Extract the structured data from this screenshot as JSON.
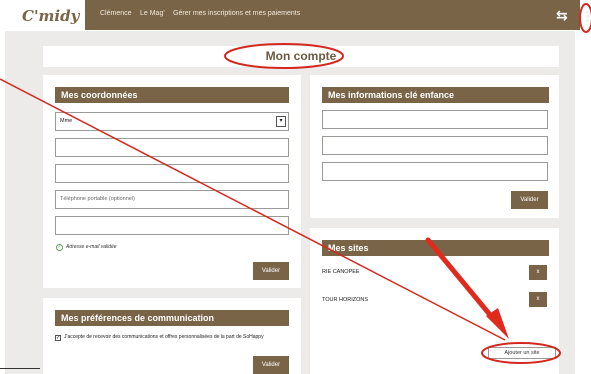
{
  "header": {
    "logo": "C'midy",
    "nav": [
      "Clémence",
      "Le Mag'",
      "Gérer mes inscriptions et mes paiements"
    ],
    "icons": [
      "swap-icon",
      "kebab-menu-icon"
    ]
  },
  "page": {
    "title": "Mon compte"
  },
  "coordonnees": {
    "title": "Mes coordonnées",
    "civilite_value": "Mme",
    "phone_placeholder": "Téléphone portable (optionnel)",
    "email_validated": "Adresse e-mail validée",
    "submit": "Valider"
  },
  "enfance": {
    "title": "Mes informations clé enfance",
    "submit": "Valider"
  },
  "sites": {
    "title": "Mes sites",
    "items": [
      {
        "name": "RIE CANOPEE",
        "remove": "x"
      },
      {
        "name": "TOUR HORIZONS",
        "remove": "x"
      }
    ],
    "add": "Ajouter un site"
  },
  "preferences": {
    "title": "Mes préférences de communication",
    "checkbox_mark": "✓",
    "consent": "J'accepte de recevoir des communications et offres personnalisées de la part de SoHappy",
    "submit": "Valider"
  },
  "colors": {
    "brand": "#7a6447",
    "annotation": "#d4281e",
    "background": "#ecebe9"
  }
}
